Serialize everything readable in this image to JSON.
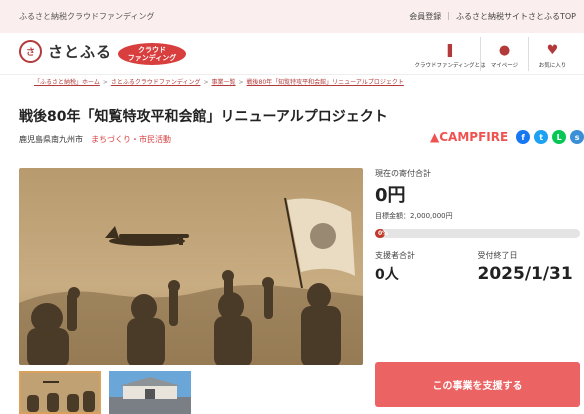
{
  "topbar": {
    "tagline": "ふるさと納税クラウドファンディング",
    "links": [
      "会員登録",
      "ふるさと納税サイトさとふるTOP"
    ]
  },
  "header": {
    "logo_mark": "さ",
    "logo_text": "さとふる",
    "badge_line1": "クラウド",
    "badge_line2": "ファンディング",
    "nav": [
      {
        "label": "クラウドファンディングとは",
        "icon": "bookmark-icon"
      },
      {
        "label": "マイページ",
        "icon": "user-icon"
      },
      {
        "label": "お気に入り",
        "icon": "heart-icon"
      }
    ]
  },
  "breadcrumb": {
    "items": [
      "「ふるさと納税」ホーム",
      "さとふるクラウドファンディング",
      "事業一覧",
      "戦後80年「知覧特攻平和会館」リニューアルプロジェクト"
    ]
  },
  "project": {
    "title": "戦後80年「知覧特攻平和会館」リニューアルプロジェクト",
    "region": "鹿児島県南九州市",
    "category": "まちづくり・市民活動"
  },
  "platform": {
    "name": "CAMPFIRE",
    "social": [
      {
        "icon": "facebook-icon",
        "glyph": "f",
        "color": "#1877f2"
      },
      {
        "icon": "twitter-icon",
        "glyph": "t",
        "color": "#1da1f2"
      },
      {
        "icon": "line-icon",
        "glyph": "L",
        "color": "#06c755"
      },
      {
        "icon": "share-icon",
        "glyph": "s",
        "color": "#3b8fd6"
      }
    ]
  },
  "funding": {
    "current_label": "現在の寄付合計",
    "current_amount": "0円",
    "goal": "目標金額：2,000,000円",
    "progress_percent": 0,
    "progress_text": "0%",
    "supporters_label": "支援者合計",
    "supporters": "0人",
    "deadline_label": "受付終了日",
    "deadline": "2025/1/31"
  },
  "cta": {
    "label": "この事業を支援する"
  },
  "colors": {
    "accent": "#d83e3e",
    "button": "#ec6363",
    "topbar": "#fbeeee"
  }
}
